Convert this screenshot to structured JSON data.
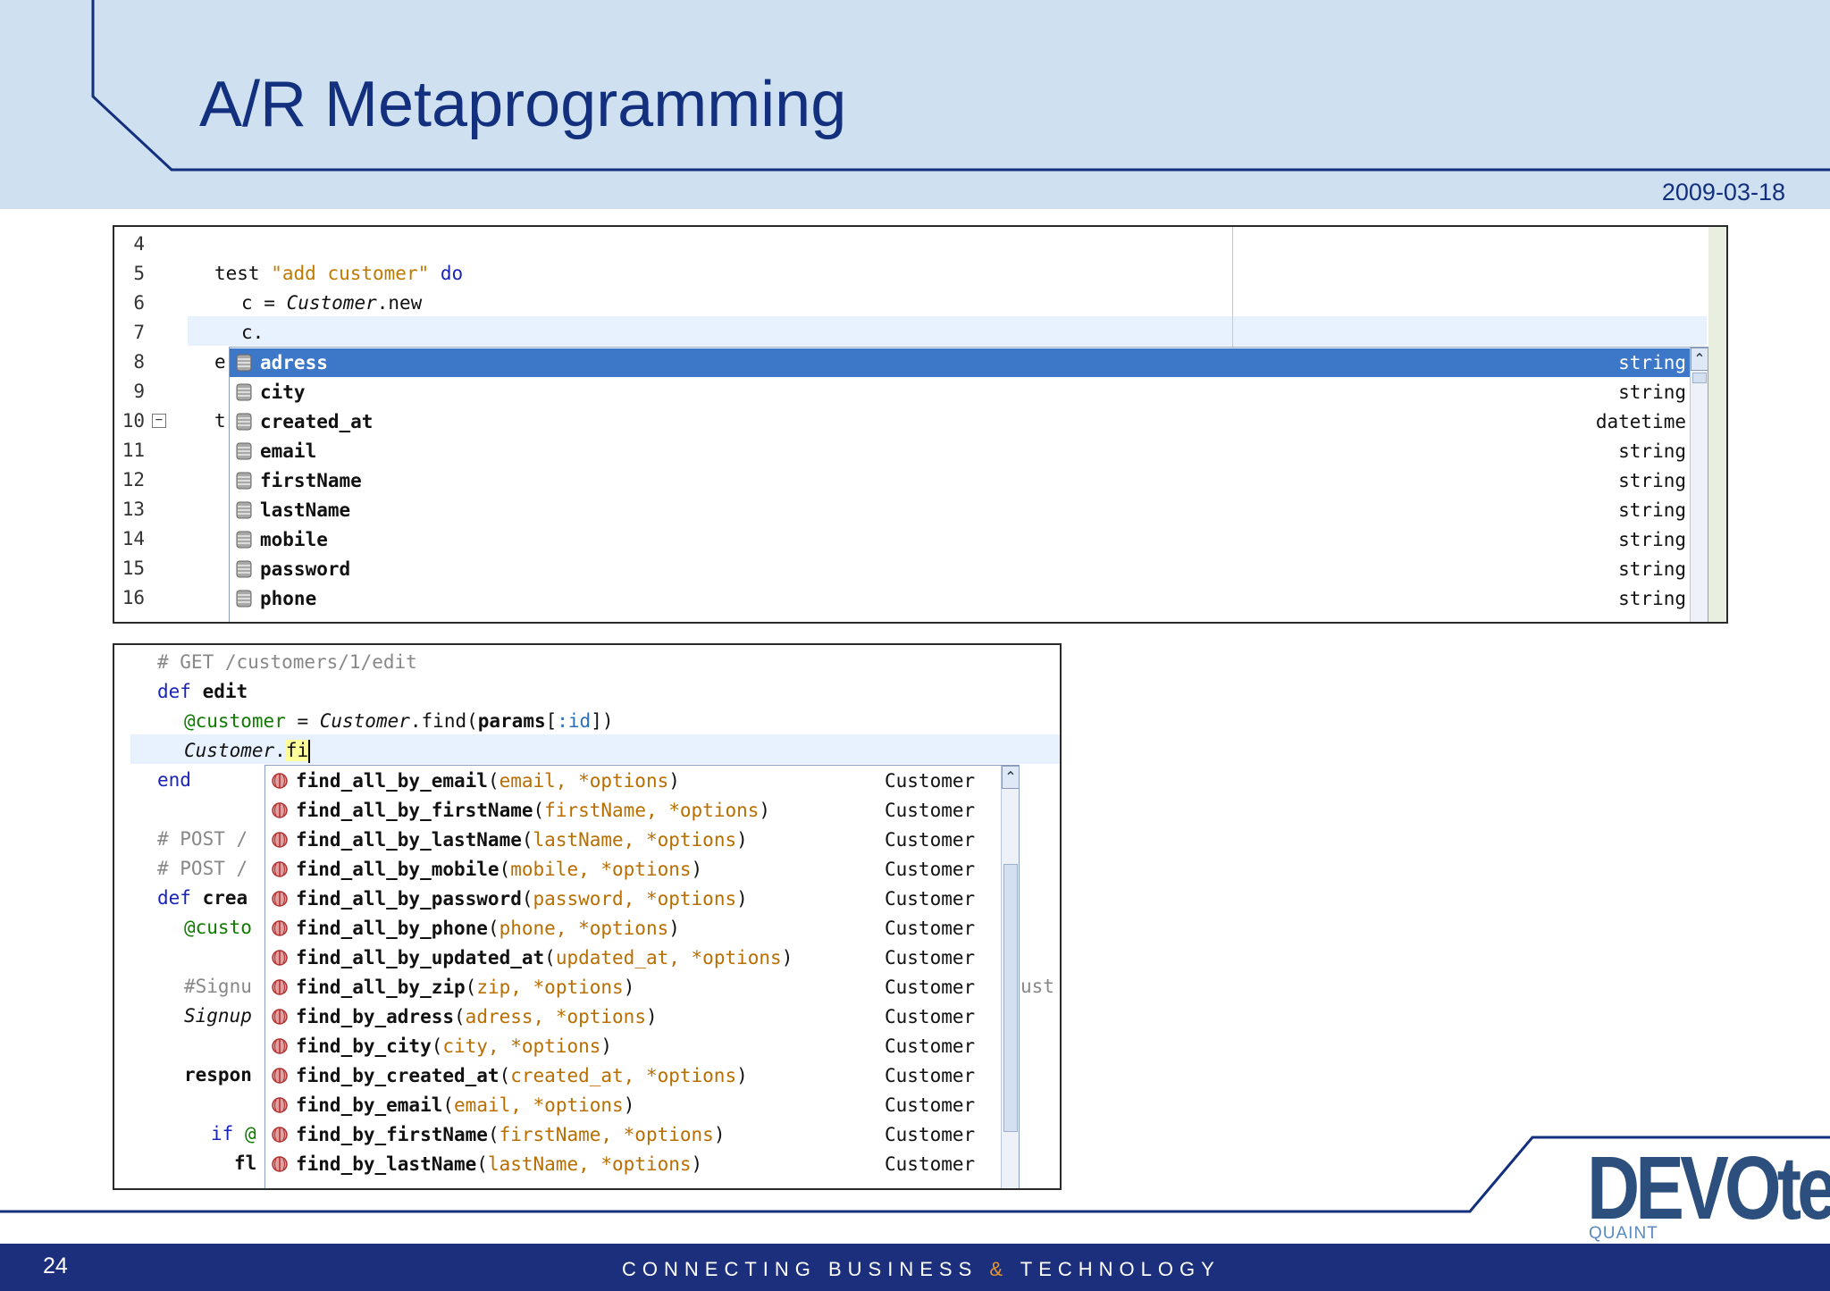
{
  "slide": {
    "title": "A/R Metaprogramming",
    "date": "2009-03-18",
    "page_number": "24",
    "tagline_left": "CONNECTING BUSINESS ",
    "tagline_amp": "&",
    "tagline_right": " TECHNOLOGY",
    "logo_word": "DEVOteam",
    "logo_sub": "QUAINT"
  },
  "editor1": {
    "line_numbers": [
      "4",
      "5",
      "6",
      "7",
      "8",
      "9",
      "10",
      "11",
      "12",
      "13",
      "14",
      "15",
      "16"
    ],
    "code": {
      "l5_kw": "test",
      "l5_str": "\"add customer\"",
      "l5_do": "do",
      "l6_var": "c =",
      "l6_cls": "Customer",
      "l6_method": ".new",
      "l7": "c.",
      "l8_frag": "e",
      "l10_frag": "t"
    },
    "autocomplete": [
      {
        "name": "adress",
        "type": "string",
        "selected": true
      },
      {
        "name": "city",
        "type": "string"
      },
      {
        "name": "created_at",
        "type": "datetime"
      },
      {
        "name": "email",
        "type": "string"
      },
      {
        "name": "firstName",
        "type": "string"
      },
      {
        "name": "lastName",
        "type": "string"
      },
      {
        "name": "mobile",
        "type": "string"
      },
      {
        "name": "password",
        "type": "string"
      },
      {
        "name": "phone",
        "type": "string"
      }
    ]
  },
  "editor2": {
    "code": {
      "comment1": "# GET /customers/1/edit",
      "def": "def",
      "def_name": "edit",
      "ivar": "@customer",
      "assign": " = ",
      "cls": "Customer",
      "find": ".find(",
      "params": "params",
      "bracket_open": "[",
      "sym": ":id",
      "bracket_close": "])",
      "typing_cls": "Customer",
      "typing_dot": ".",
      "typing_typed": "fi",
      "end": "end",
      "comment2": "# POST /",
      "comment3": "# POST /",
      "def2": "def",
      "def2_frag": "crea",
      "ivar2": "@custo",
      "comment4": "#Signu",
      "signup": "Signup",
      "respond": "respon",
      "if_kw": "if",
      "if_ivar": "@",
      "fl": "fl",
      "right_frag": "ust"
    },
    "autocomplete": [
      {
        "name": "find_all_by_email",
        "params": "email, *options",
        "type": "Customer"
      },
      {
        "name": "find_all_by_firstName",
        "params": "firstName, *options",
        "type": "Customer"
      },
      {
        "name": "find_all_by_lastName",
        "params": "lastName, *options",
        "type": "Customer"
      },
      {
        "name": "find_all_by_mobile",
        "params": "mobile, *options",
        "type": "Customer"
      },
      {
        "name": "find_all_by_password",
        "params": "password, *options",
        "type": "Customer"
      },
      {
        "name": "find_all_by_phone",
        "params": "phone, *options",
        "type": "Customer"
      },
      {
        "name": "find_all_by_updated_at",
        "params": "updated_at, *options",
        "type": "Customer"
      },
      {
        "name": "find_all_by_zip",
        "params": "zip, *options",
        "type": "Customer"
      },
      {
        "name": "find_by_adress",
        "params": "adress, *options",
        "type": "Customer"
      },
      {
        "name": "find_by_city",
        "params": "city, *options",
        "type": "Customer"
      },
      {
        "name": "find_by_created_at",
        "params": "created_at, *options",
        "type": "Customer"
      },
      {
        "name": "find_by_email",
        "params": "email, *options",
        "type": "Customer"
      },
      {
        "name": "find_by_firstName",
        "params": "firstName, *options",
        "type": "Customer"
      },
      {
        "name": "find_by_lastName",
        "params": "lastName, *options",
        "type": "Customer"
      }
    ]
  },
  "icons": {
    "field": "database-field-icon",
    "method": "ruby-method-icon",
    "scroll_up": "scroll-up-arrow-icon",
    "fold": "fold-minus-icon"
  },
  "colors": {
    "header_band": "#cfe0f0",
    "title": "#13307e",
    "footer_band": "#1c2f7c",
    "selection": "#3d78c8",
    "accent_amp": "#e8962e"
  }
}
